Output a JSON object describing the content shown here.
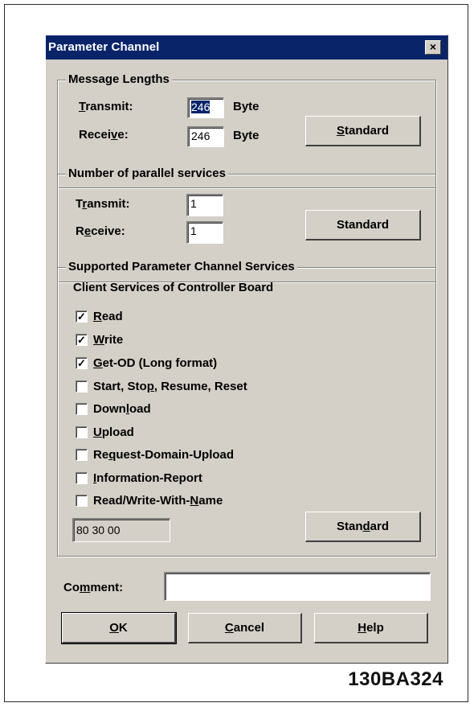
{
  "dialog": {
    "title": "Parameter Channel",
    "close_glyph": "×"
  },
  "message_lengths": {
    "legend": "Message Lengths",
    "transmit_label": "Transmit:",
    "transmit_value": "246",
    "transmit_unit": "Byte",
    "receive_label": "Receive:",
    "receive_value": "246",
    "receive_unit": "Byte",
    "standard_label": "Standard"
  },
  "parallel_services": {
    "legend": "Number of parallel services",
    "transmit_label": "Transmit:",
    "transmit_value": "1",
    "receive_label": "Receive:",
    "receive_value": "1",
    "standard_label": "Standard"
  },
  "supported_services": {
    "legend": "Supported Parameter Channel Services",
    "subtitle": "Client Services of Controller Board",
    "items": [
      {
        "label": "Read",
        "checked": true
      },
      {
        "label": "Write",
        "checked": true
      },
      {
        "label": "Get-OD (Long format)",
        "checked": true
      },
      {
        "label": "Start, Stop, Resume, Reset",
        "checked": false
      },
      {
        "label": "Download",
        "checked": false
      },
      {
        "label": "Upload",
        "checked": false
      },
      {
        "label": "Request-Domain-Upload",
        "checked": false
      },
      {
        "label": "Information-Report",
        "checked": false
      },
      {
        "label": "Read/Write-With-Name",
        "checked": false
      }
    ],
    "hex_value": "80 30 00",
    "standard_label": "Standard"
  },
  "comment": {
    "label": "Comment:",
    "value": ""
  },
  "buttons": {
    "ok": "OK",
    "cancel": "Cancel",
    "help": "Help"
  },
  "figure_id": "130BA324"
}
